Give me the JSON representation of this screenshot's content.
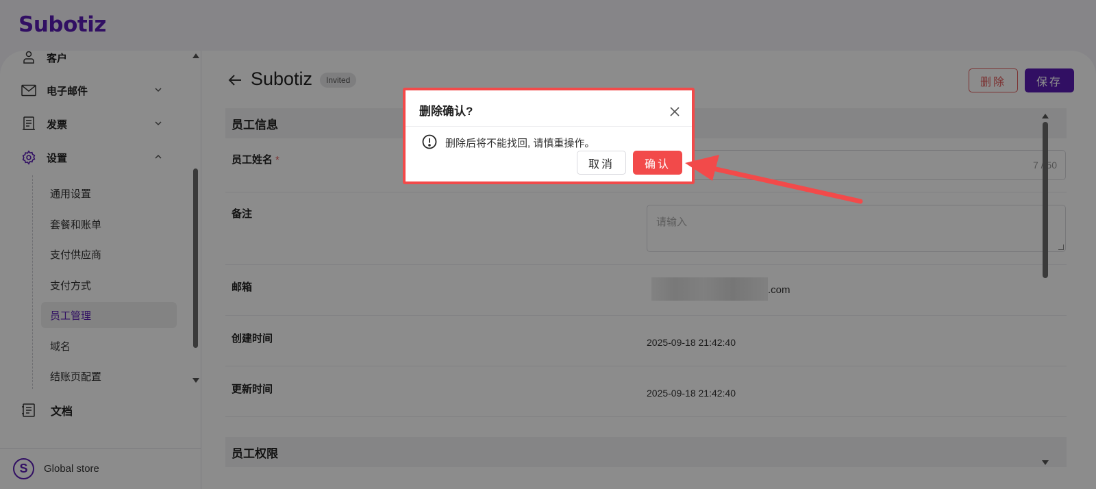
{
  "app": {
    "logo": "Subotiz"
  },
  "sidebar": {
    "items": [
      {
        "label": "客户"
      },
      {
        "label": "电子邮件"
      },
      {
        "label": "发票"
      },
      {
        "label": "设置"
      }
    ],
    "settings_sub": [
      {
        "label": "通用设置"
      },
      {
        "label": "套餐和账单"
      },
      {
        "label": "支付供应商"
      },
      {
        "label": "支付方式"
      },
      {
        "label": "员工管理"
      },
      {
        "label": "域名"
      },
      {
        "label": "结账页配置"
      }
    ],
    "docs": "文档",
    "store": {
      "initial": "S",
      "name": "Global store"
    }
  },
  "header": {
    "title": "Subotiz",
    "badge": "Invited",
    "delete_label": "删除",
    "save_label": "保存"
  },
  "sections": {
    "info_title": "员工信息",
    "perm_title": "员工权限"
  },
  "form": {
    "name_label": "员工姓名",
    "name_required": "*",
    "name_counter": "7 / 50",
    "note_label": "备注",
    "note_placeholder": "请输入",
    "email_label": "邮箱",
    "email_suffix": ".com",
    "created_label": "创建时间",
    "created_value": "2025-09-18 21:42:40",
    "updated_label": "更新时间",
    "updated_value": "2025-09-18 21:42:40"
  },
  "dialog": {
    "title": "删除确认?",
    "message": "删除后将不能找回, 请慎重操作。",
    "cancel_label": "取消",
    "confirm_label": "确认"
  },
  "colors": {
    "brand": "#5a1db5",
    "danger": "#f24a4a",
    "annotation": "#f24a4a"
  }
}
